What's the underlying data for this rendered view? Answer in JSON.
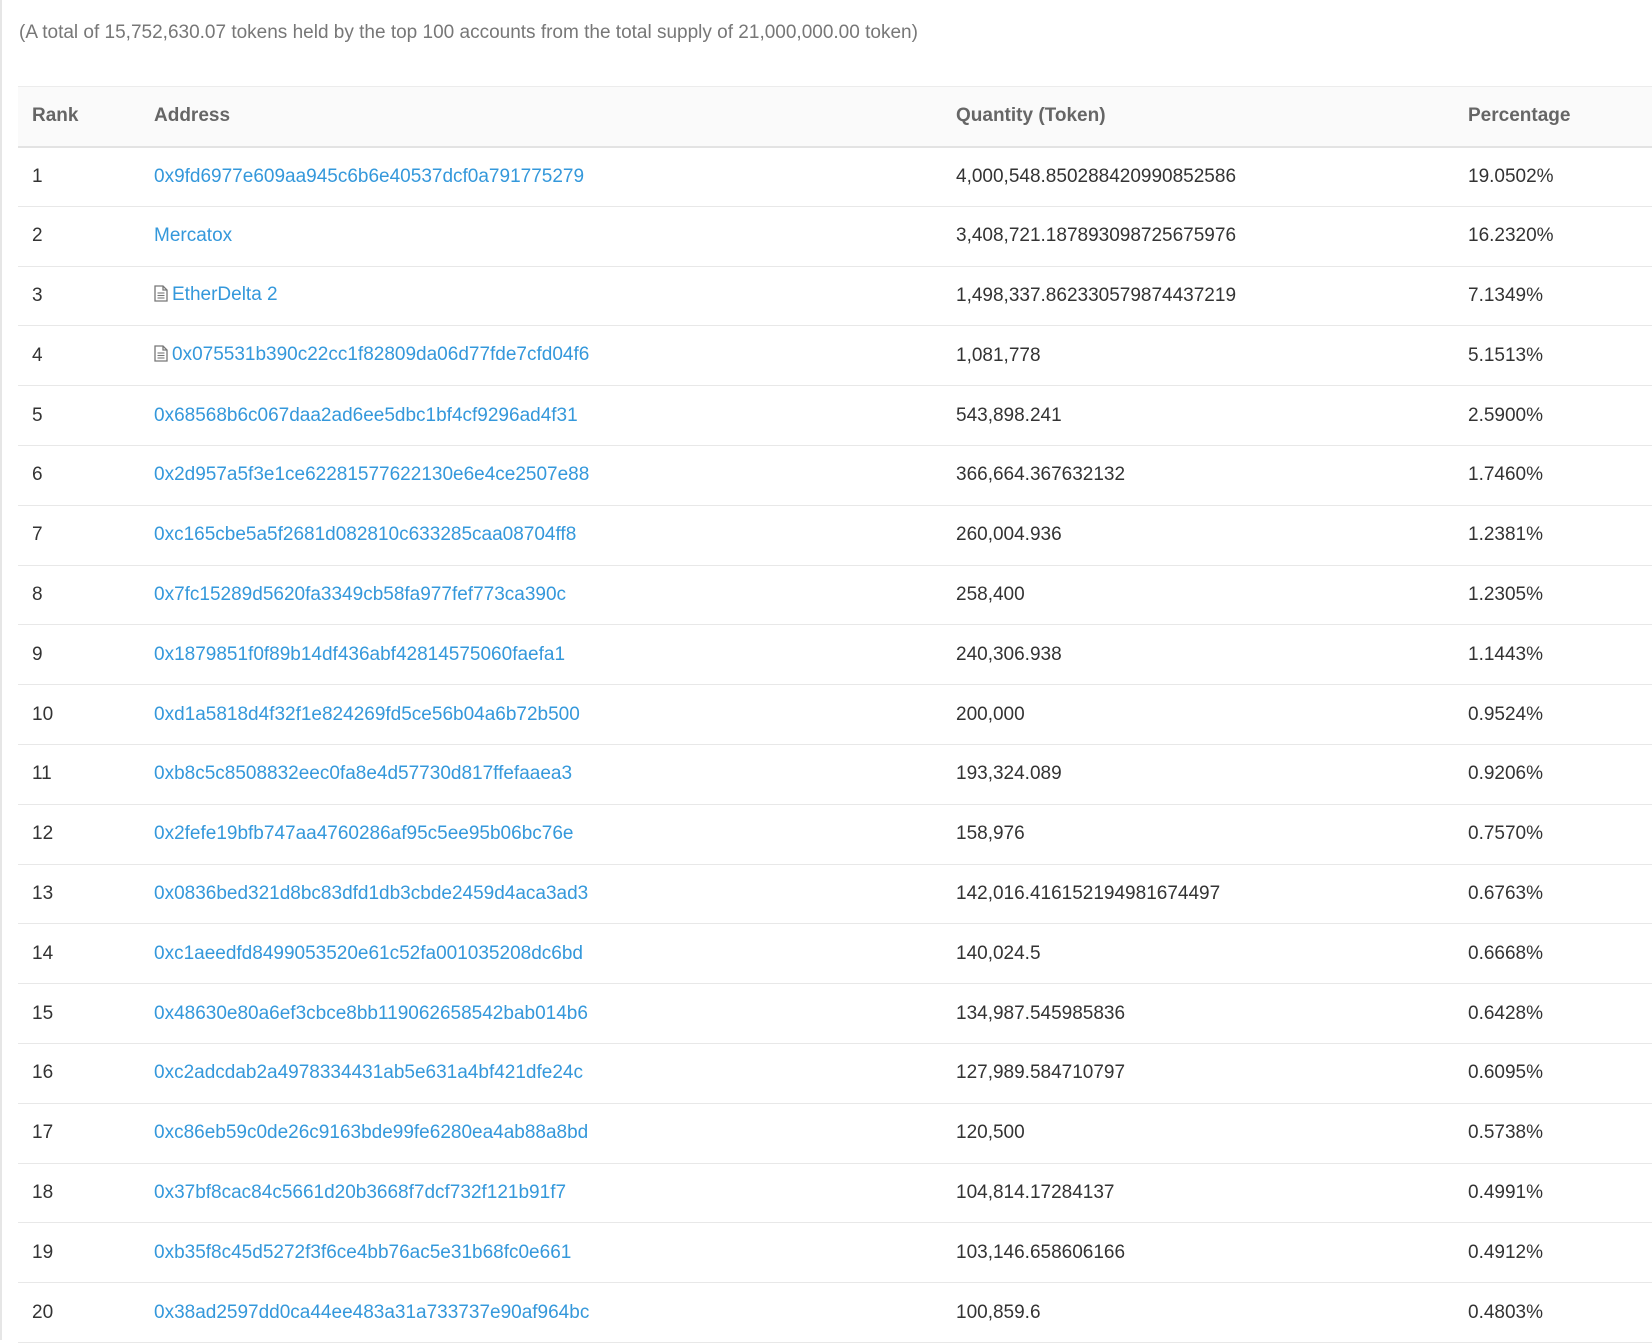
{
  "summary": "(A total of 15,752,630.07 tokens held by the top 100 accounts from the total supply of 21,000,000.00 token)",
  "table": {
    "headers": {
      "rank": "Rank",
      "address": "Address",
      "quantity": "Quantity (Token)",
      "percentage": "Percentage"
    },
    "rows": [
      {
        "rank": "1",
        "address": "0x9fd6977e609aa945c6b6e40537dcf0a791775279",
        "is_contract": false,
        "quantity": "4,000,548.850288420990852586",
        "percentage": "19.0502%"
      },
      {
        "rank": "2",
        "address": "Mercatox",
        "is_contract": false,
        "quantity": "3,408,721.187893098725675976",
        "percentage": "16.2320%"
      },
      {
        "rank": "3",
        "address": "EtherDelta 2",
        "is_contract": true,
        "quantity": "1,498,337.862330579874437219",
        "percentage": "7.1349%"
      },
      {
        "rank": "4",
        "address": "0x075531b390c22cc1f82809da06d77fde7cfd04f6",
        "is_contract": true,
        "quantity": "1,081,778",
        "percentage": "5.1513%"
      },
      {
        "rank": "5",
        "address": "0x68568b6c067daa2ad6ee5dbc1bf4cf9296ad4f31",
        "is_contract": false,
        "quantity": "543,898.241",
        "percentage": "2.5900%"
      },
      {
        "rank": "6",
        "address": "0x2d957a5f3e1ce62281577622130e6e4ce2507e88",
        "is_contract": false,
        "quantity": "366,664.367632132",
        "percentage": "1.7460%"
      },
      {
        "rank": "7",
        "address": "0xc165cbe5a5f2681d082810c633285caa08704ff8",
        "is_contract": false,
        "quantity": "260,004.936",
        "percentage": "1.2381%"
      },
      {
        "rank": "8",
        "address": "0x7fc15289d5620fa3349cb58fa977fef773ca390c",
        "is_contract": false,
        "quantity": "258,400",
        "percentage": "1.2305%"
      },
      {
        "rank": "9",
        "address": "0x1879851f0f89b14df436abf42814575060faefa1",
        "is_contract": false,
        "quantity": "240,306.938",
        "percentage": "1.1443%"
      },
      {
        "rank": "10",
        "address": "0xd1a5818d4f32f1e824269fd5ce56b04a6b72b500",
        "is_contract": false,
        "quantity": "200,000",
        "percentage": "0.9524%"
      },
      {
        "rank": "11",
        "address": "0xb8c5c8508832eec0fa8e4d57730d817ffefaaea3",
        "is_contract": false,
        "quantity": "193,324.089",
        "percentage": "0.9206%"
      },
      {
        "rank": "12",
        "address": "0x2fefe19bfb747aa4760286af95c5ee95b06bc76e",
        "is_contract": false,
        "quantity": "158,976",
        "percentage": "0.7570%"
      },
      {
        "rank": "13",
        "address": "0x0836bed321d8bc83dfd1db3cbde2459d4aca3ad3",
        "is_contract": false,
        "quantity": "142,016.416152194981674497",
        "percentage": "0.6763%"
      },
      {
        "rank": "14",
        "address": "0xc1aeedfd8499053520e61c52fa001035208dc6bd",
        "is_contract": false,
        "quantity": "140,024.5",
        "percentage": "0.6668%"
      },
      {
        "rank": "15",
        "address": "0x48630e80a6ef3cbce8bb119062658542bab014b6",
        "is_contract": false,
        "quantity": "134,987.545985836",
        "percentage": "0.6428%"
      },
      {
        "rank": "16",
        "address": "0xc2adcdab2a4978334431ab5e631a4bf421dfe24c",
        "is_contract": false,
        "quantity": "127,989.584710797",
        "percentage": "0.6095%"
      },
      {
        "rank": "17",
        "address": "0xc86eb59c0de26c9163bde99fe6280ea4ab88a8bd",
        "is_contract": false,
        "quantity": "120,500",
        "percentage": "0.5738%"
      },
      {
        "rank": "18",
        "address": "0x37bf8cac84c5661d20b3668f7dcf732f121b91f7",
        "is_contract": false,
        "quantity": "104,814.17284137",
        "percentage": "0.4991%"
      },
      {
        "rank": "19",
        "address": "0xb35f8c45d5272f3f6ce4bb76ac5e31b68fc0e661",
        "is_contract": false,
        "quantity": "103,146.658606166",
        "percentage": "0.4912%"
      },
      {
        "rank": "20",
        "address": "0x38ad2597dd0ca44ee483a31a733737e90af964bc",
        "is_contract": false,
        "quantity": "100,859.6",
        "percentage": "0.4803%"
      }
    ]
  }
}
